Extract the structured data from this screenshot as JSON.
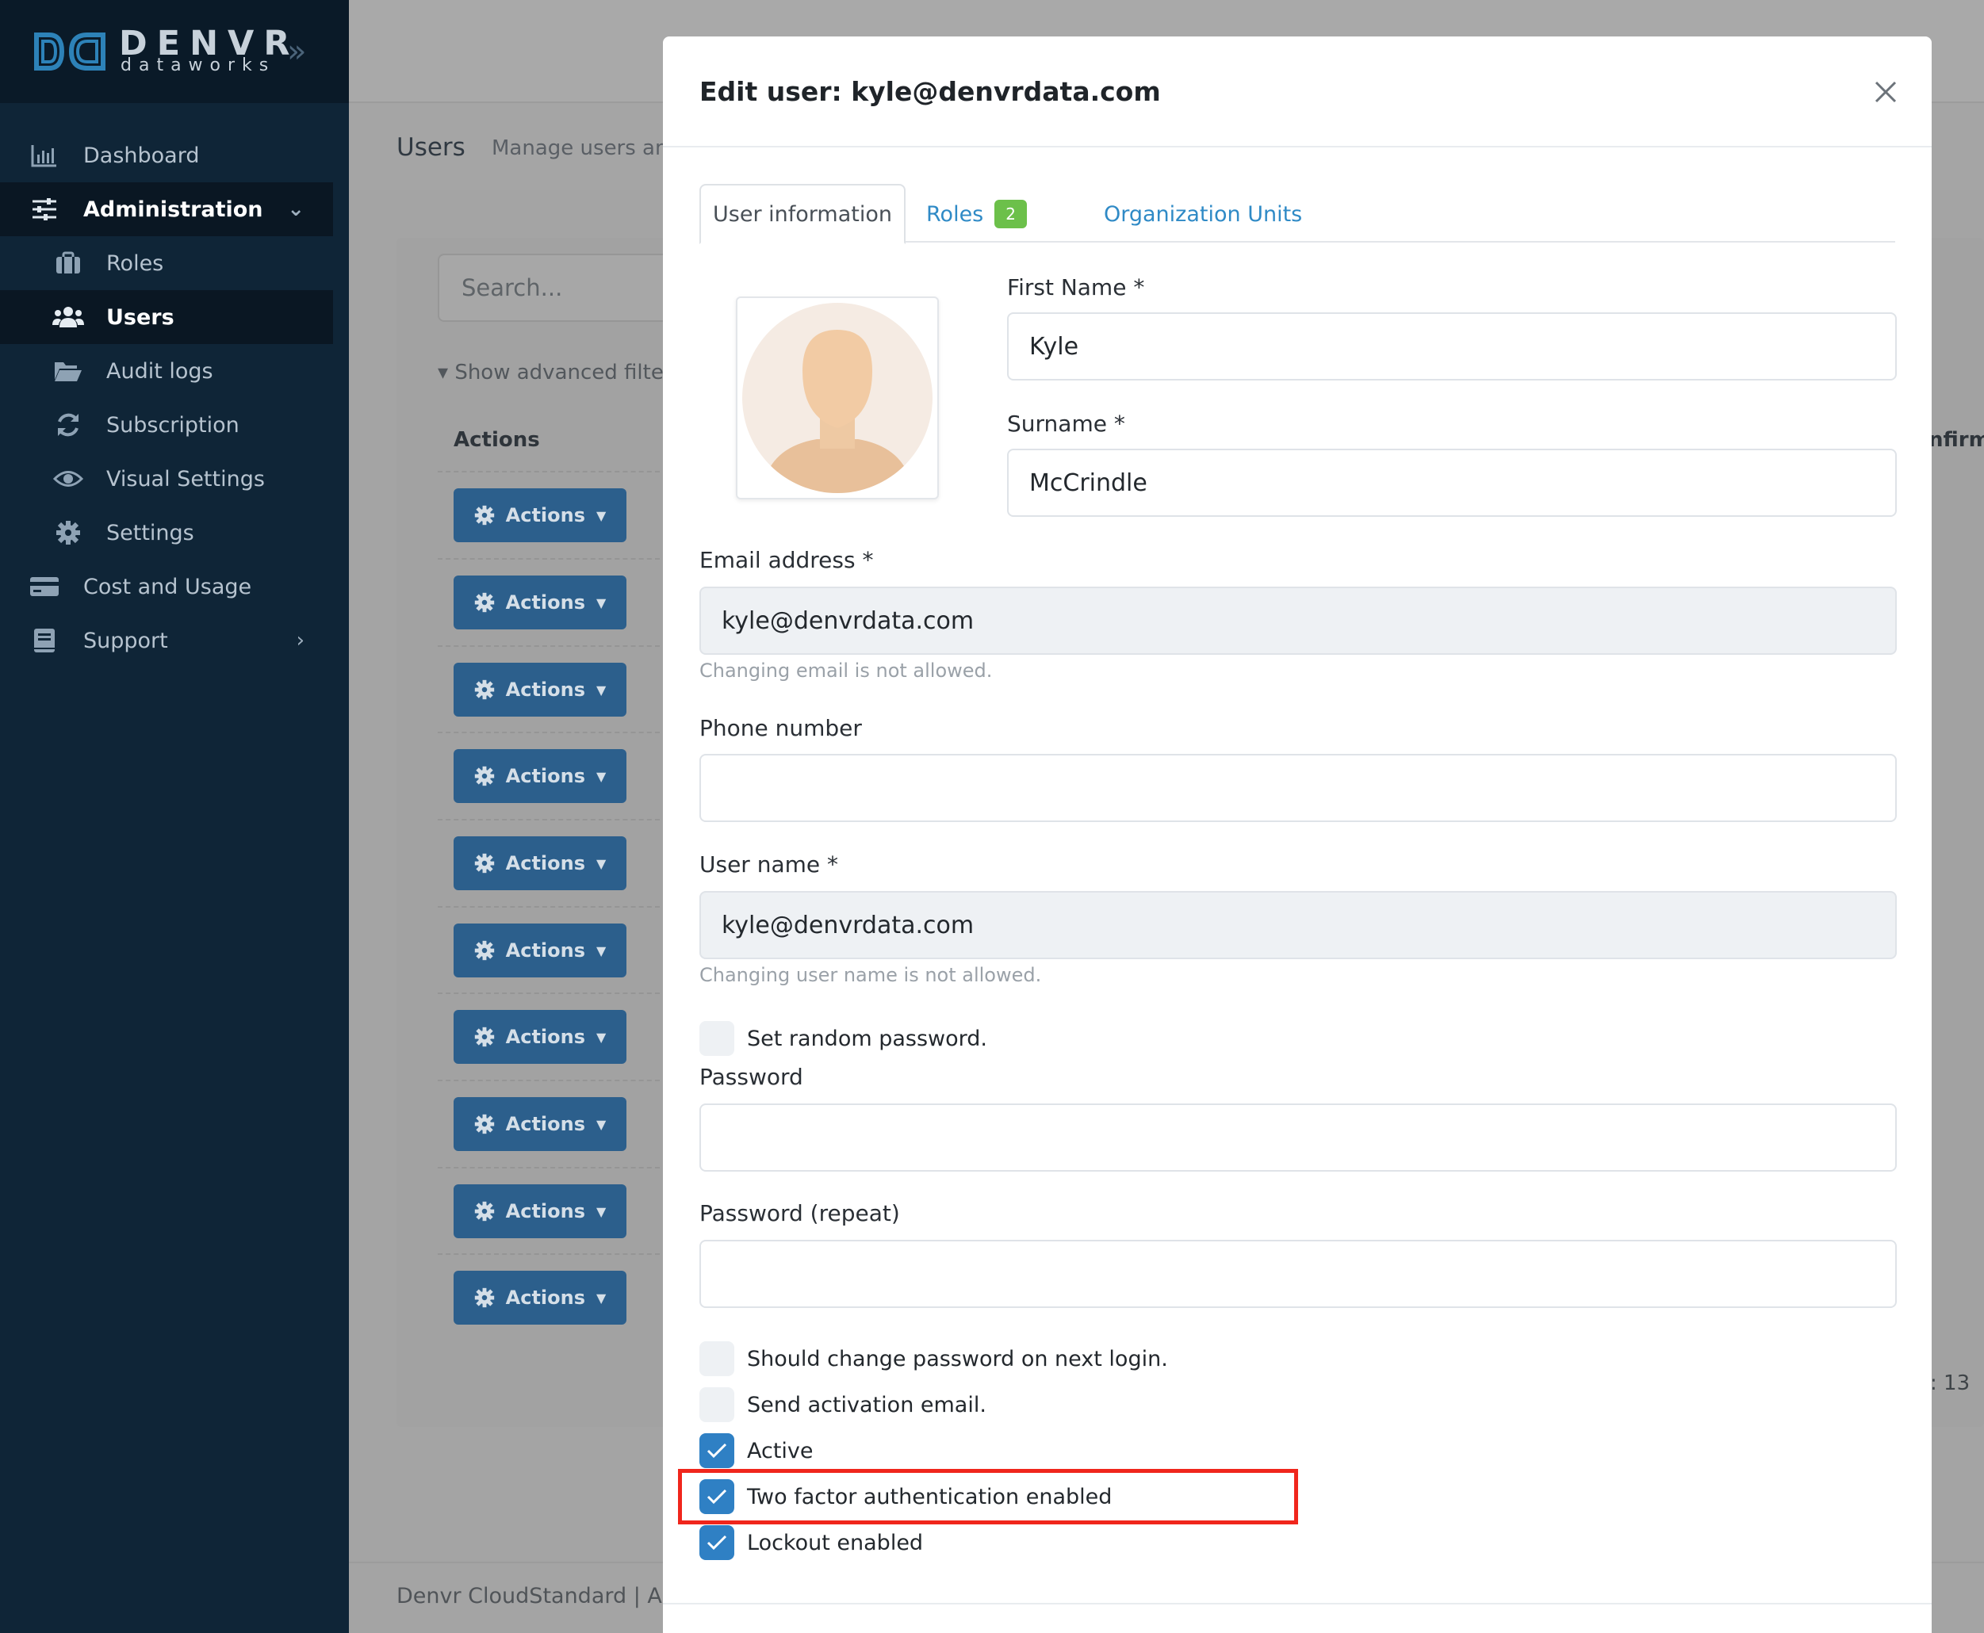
{
  "brand": {
    "name": "DENVR",
    "subtitle": "dataworks"
  },
  "sidebar": {
    "items": [
      {
        "label": "Dashboard",
        "icon": "bar-chart-icon"
      },
      {
        "label": "Administration",
        "icon": "sliders-icon"
      },
      {
        "label": "Roles",
        "icon": "briefcase-icon"
      },
      {
        "label": "Users",
        "icon": "users-icon"
      },
      {
        "label": "Audit logs",
        "icon": "folder-open-icon"
      },
      {
        "label": "Subscription",
        "icon": "refresh-icon"
      },
      {
        "label": "Visual Settings",
        "icon": "eye-icon"
      },
      {
        "label": "Settings",
        "icon": "gear-icon"
      },
      {
        "label": "Cost and Usage",
        "icon": "credit-card-icon"
      },
      {
        "label": "Support",
        "icon": "book-icon"
      }
    ]
  },
  "page": {
    "title": "Users",
    "description": "Manage users and",
    "search_placeholder": "Search...",
    "advanced_filters": "Show advanced filters",
    "col_actions": "Actions",
    "col_confirm": "nfirm",
    "total": ": 13",
    "action_label": "Actions",
    "footer": "Denvr CloudStandard | API:"
  },
  "modal": {
    "title": "Edit user: kyle@denvrdata.com",
    "tabs": {
      "user_info": "User information",
      "roles": "Roles",
      "roles_count": "2",
      "org_units": "Organization Units"
    },
    "first_name": {
      "label": "First Name *",
      "value": "Kyle"
    },
    "surname": {
      "label": "Surname *",
      "value": "McCrindle"
    },
    "email": {
      "label": "Email address *",
      "value": "kyle@denvrdata.com",
      "help": "Changing email is not allowed."
    },
    "phone": {
      "label": "Phone number",
      "value": ""
    },
    "username": {
      "label": "User name *",
      "value": "kyle@denvrdata.com",
      "help": "Changing user name is not allowed."
    },
    "random_password": {
      "label": "Set random password.",
      "checked": false
    },
    "password": {
      "label": "Password",
      "value": ""
    },
    "password_repeat": {
      "label": "Password (repeat)",
      "value": ""
    },
    "checkboxes": {
      "change_password": {
        "label": "Should change password on next login.",
        "checked": false
      },
      "activation_email": {
        "label": "Send activation email.",
        "checked": false
      },
      "active": {
        "label": "Active",
        "checked": true
      },
      "two_factor": {
        "label": "Two factor authentication enabled",
        "checked": true
      },
      "lockout": {
        "label": "Lockout enabled",
        "checked": true
      }
    }
  },
  "colors": {
    "accent": "#2f80c4",
    "sidebar": "#0f2537",
    "badge": "#6cc04a",
    "highlight": "#f0261c"
  }
}
